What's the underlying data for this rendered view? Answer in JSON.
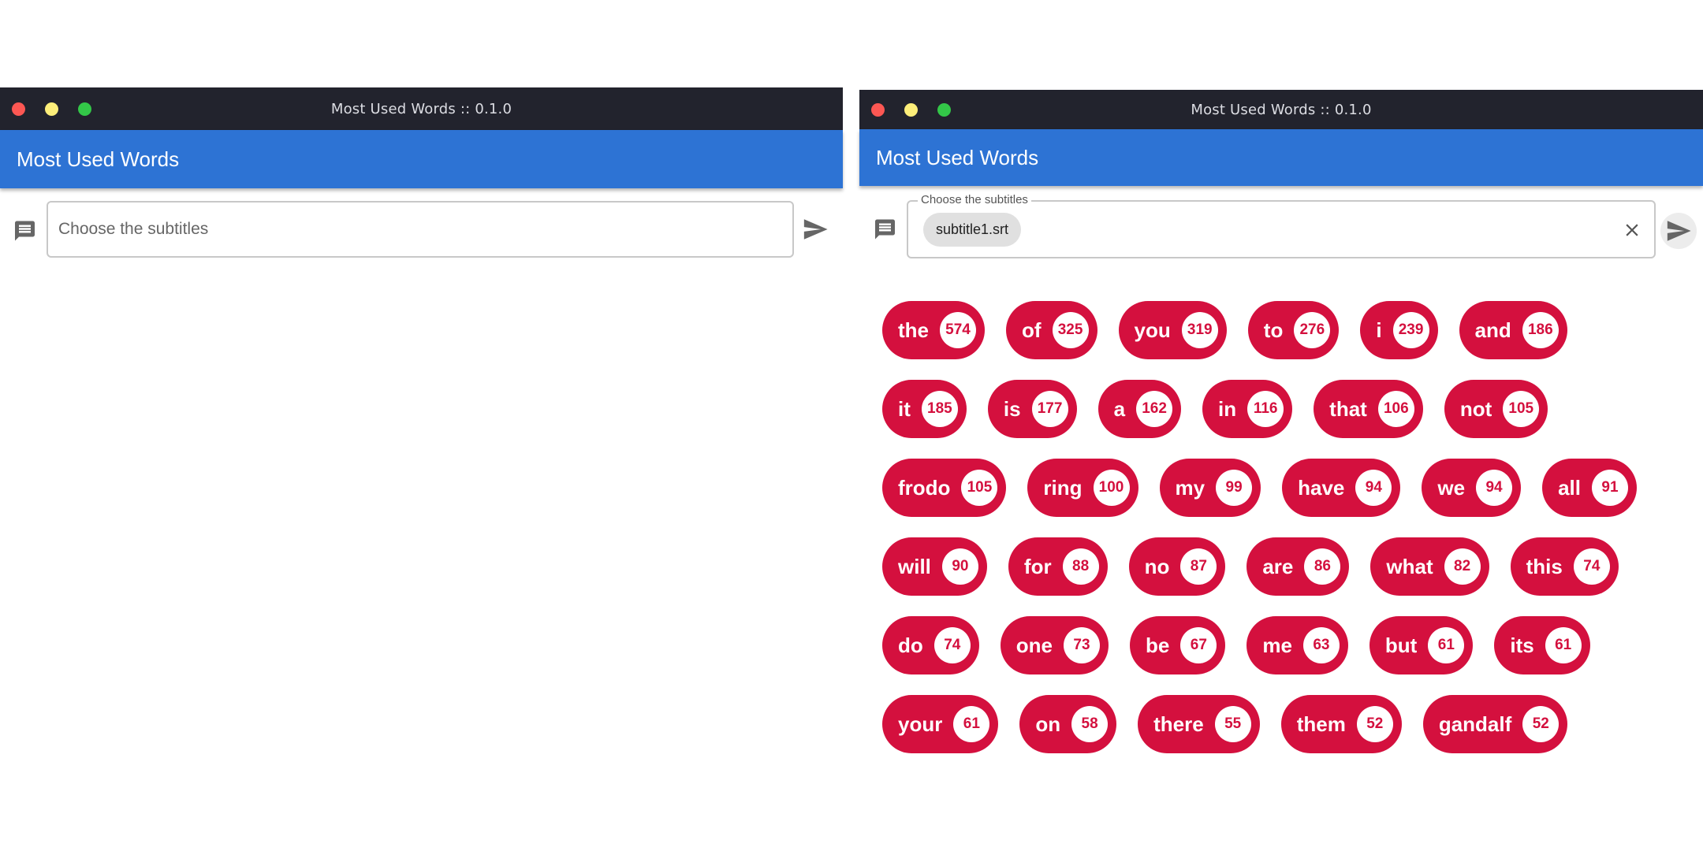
{
  "left_window": {
    "title": "Most Used Words :: 0.1.0",
    "app_title": "Most Used Words",
    "input": {
      "placeholder": "Choose the subtitles"
    }
  },
  "right_window": {
    "title": "Most Used Words :: 0.1.0",
    "app_title": "Most Used Words",
    "input": {
      "label": "Choose the subtitles",
      "chip": "subtitle1.srt"
    },
    "word_rows": [
      [
        {
          "word": "the",
          "count": "574"
        },
        {
          "word": "of",
          "count": "325"
        },
        {
          "word": "you",
          "count": "319"
        },
        {
          "word": "to",
          "count": "276"
        },
        {
          "word": "i",
          "count": "239"
        },
        {
          "word": "and",
          "count": "186"
        }
      ],
      [
        {
          "word": "it",
          "count": "185"
        },
        {
          "word": "is",
          "count": "177"
        },
        {
          "word": "a",
          "count": "162"
        },
        {
          "word": "in",
          "count": "116"
        },
        {
          "word": "that",
          "count": "106"
        },
        {
          "word": "not",
          "count": "105"
        }
      ],
      [
        {
          "word": "frodo",
          "count": "105"
        },
        {
          "word": "ring",
          "count": "100"
        },
        {
          "word": "my",
          "count": "99"
        },
        {
          "word": "have",
          "count": "94"
        },
        {
          "word": "we",
          "count": "94"
        },
        {
          "word": "all",
          "count": "91"
        }
      ],
      [
        {
          "word": "will",
          "count": "90"
        },
        {
          "word": "for",
          "count": "88"
        },
        {
          "word": "no",
          "count": "87"
        },
        {
          "word": "are",
          "count": "86"
        },
        {
          "word": "what",
          "count": "82"
        },
        {
          "word": "this",
          "count": "74"
        }
      ],
      [
        {
          "word": "do",
          "count": "74"
        },
        {
          "word": "one",
          "count": "73"
        },
        {
          "word": "be",
          "count": "67"
        },
        {
          "word": "me",
          "count": "63"
        },
        {
          "word": "but",
          "count": "61"
        },
        {
          "word": "its",
          "count": "61"
        }
      ],
      [
        {
          "word": "your",
          "count": "61"
        },
        {
          "word": "on",
          "count": "58"
        },
        {
          "word": "there",
          "count": "55"
        },
        {
          "word": "them",
          "count": "52"
        },
        {
          "word": "gandalf",
          "count": "52"
        }
      ]
    ]
  },
  "colors": {
    "titlebar": "#22232d",
    "appbar": "#2d73d4",
    "word_chip": "#d4103e",
    "traffic_close": "#fc5753",
    "traffic_minimize": "#fdee7a",
    "traffic_maximize": "#33c748"
  },
  "icons": {
    "input_prefix": "message-icon",
    "send": "send-icon",
    "clear": "close-icon"
  }
}
